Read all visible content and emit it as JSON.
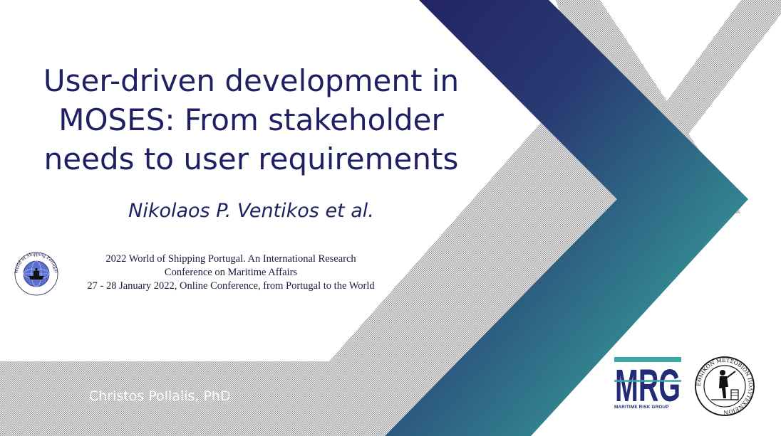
{
  "slide": {
    "title_lines": [
      "User-driven development in",
      "MOSES: From stakeholder",
      "needs to user requirements"
    ],
    "author": "Nikolaos P. Ventikos et al.",
    "conference_lines": [
      "2022 World of Shipping Portugal. An International Research",
      "Conference on Maritime Affairs",
      "27 - 28 January 2022, Online Conference, from Portugal to the World"
    ],
    "presenter": "Christos Pollalis, PhD"
  },
  "logos": {
    "wsp_ring_text": "World of Shipping Portugal",
    "mrg_letters": "MRG",
    "mrg_caption": "MARITIME RISK GROUP",
    "ntua_ring_text": "ΕΘΝΙΚΟΝ ΜΕΤΣΟΒΙΟΝ ΠΟΛΥΤΕΧΝΕΙΟΝ"
  },
  "colors": {
    "title": "#1f1f63",
    "gradient_start": "#232060",
    "gradient_end": "#3fb5a8",
    "hatch": "#a9a9a9",
    "mrg_blue": "#232a78",
    "mrg_teal": "#3aa9a3"
  }
}
